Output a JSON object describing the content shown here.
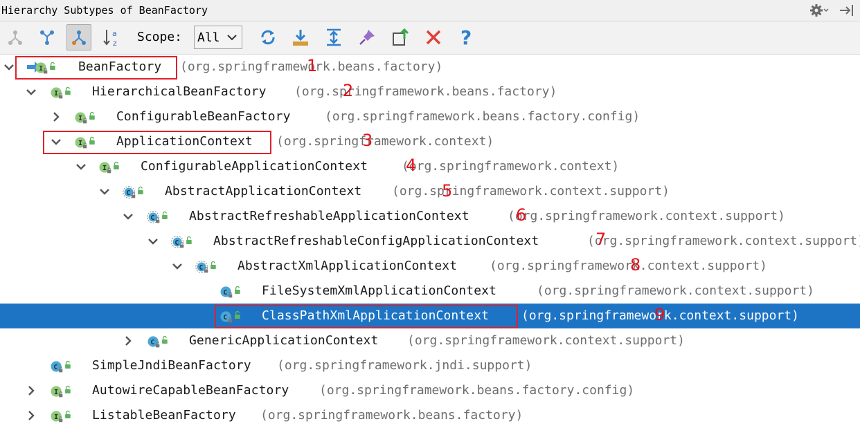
{
  "window": {
    "title": "Hierarchy Subtypes of BeanFactory",
    "icons": [
      "gear-icon",
      "hide-panel-icon"
    ]
  },
  "toolbar": {
    "buttons": [
      {
        "name": "supertype-hierarchy",
        "icon": "supertype-hierarchy-icon"
      },
      {
        "name": "subtype-hierarchy",
        "icon": "subtype-hierarchy-icon"
      },
      {
        "name": "class-hierarchy",
        "icon": "class-hierarchy-icon",
        "active": true
      },
      {
        "name": "sort-alphabetically",
        "icon": "sort-az-icon"
      },
      {
        "name": "refresh",
        "icon": "refresh-icon"
      },
      {
        "name": "export",
        "icon": "export-icon"
      },
      {
        "name": "expand-all",
        "icon": "expand-all-icon"
      },
      {
        "name": "pin-tab",
        "icon": "pin-icon"
      },
      {
        "name": "open-in-new-tab",
        "icon": "open-tab-icon"
      },
      {
        "name": "close",
        "icon": "close-icon"
      },
      {
        "name": "help",
        "icon": "help-icon"
      }
    ],
    "scope_label": "Scope:",
    "scope_value": "All"
  },
  "tree": [
    {
      "name": "BeanFactory",
      "package": "(org.springframework.beans.factory)",
      "kind": "I",
      "expanded": true,
      "marker": "1"
    },
    {
      "name": "HierarchicalBeanFactory",
      "package": "(org.springframework.beans.factory)",
      "kind": "I",
      "expanded": true,
      "marker": "2"
    },
    {
      "name": "ConfigurableBeanFactory",
      "package": "(org.springframework.beans.factory.config)",
      "kind": "I",
      "expanded": false,
      "marker": ""
    },
    {
      "name": "ApplicationContext",
      "package": "(org.springframework.context)",
      "kind": "I",
      "expanded": true,
      "marker": "3"
    },
    {
      "name": "ConfigurableApplicationContext",
      "package": "(org.springframework.context)",
      "kind": "I",
      "expanded": true,
      "marker": "4"
    },
    {
      "name": "AbstractApplicationContext",
      "package": "(org.springframework.context.support)",
      "kind": "AC",
      "expanded": true,
      "marker": "5"
    },
    {
      "name": "AbstractRefreshableApplicationContext",
      "package": "(org.springframework.context.support)",
      "kind": "AC",
      "expanded": true,
      "marker": "6"
    },
    {
      "name": "AbstractRefreshableConfigApplicationContext",
      "package": "(org.springframework.context.support)",
      "kind": "AC",
      "expanded": true,
      "marker": "7"
    },
    {
      "name": "AbstractXmlApplicationContext",
      "package": "(org.springframework.context.support)",
      "kind": "AC",
      "expanded": true,
      "marker": "8"
    },
    {
      "name": "FileSystemXmlApplicationContext",
      "package": "(org.springframework.context.support)",
      "kind": "C",
      "expanded": null,
      "marker": ""
    },
    {
      "name": "ClassPathXmlApplicationContext",
      "package": "(org.springframework.context.support)",
      "kind": "C",
      "expanded": null,
      "marker": "9",
      "selected": true
    },
    {
      "name": "GenericApplicationContext",
      "package": "(org.springframework.context.support)",
      "kind": "C",
      "expanded": false,
      "marker": ""
    },
    {
      "name": "SimpleJndiBeanFactory",
      "package": "(org.springframework.jndi.support)",
      "kind": "C",
      "expanded": null,
      "marker": ""
    },
    {
      "name": "AutowireCapableBeanFactory",
      "package": "(org.springframework.beans.factory.config)",
      "kind": "I",
      "expanded": false,
      "marker": ""
    },
    {
      "name": "ListableBeanFactory",
      "package": "(org.springframework.beans.factory)",
      "kind": "I",
      "expanded": false,
      "marker": ""
    }
  ],
  "colors": {
    "selection": "#1e74c4",
    "annotation_red": "#e0202a",
    "interface_badge": "#8fcb7a",
    "class_badge": "#4aa6d6"
  }
}
